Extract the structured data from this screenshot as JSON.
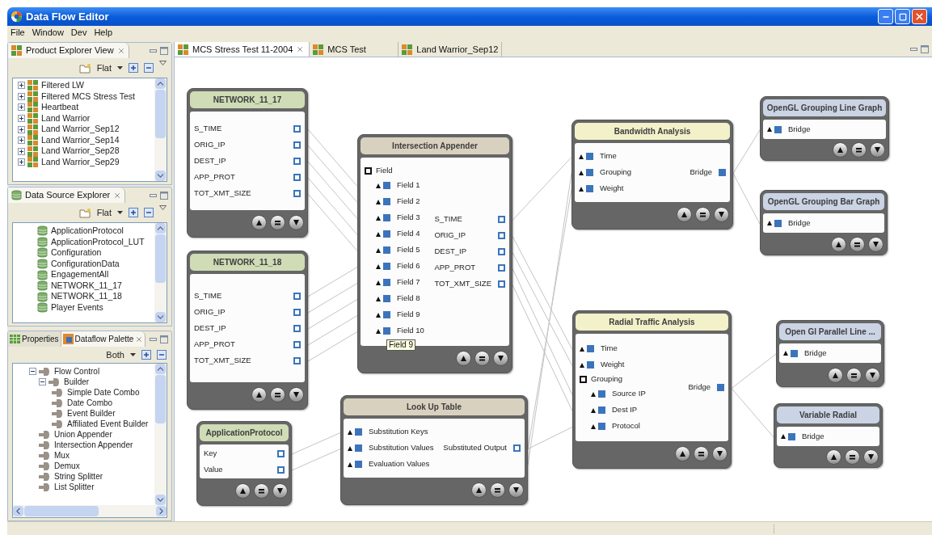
{
  "window": {
    "title": "Data Flow Editor"
  },
  "menu": [
    "File",
    "Window",
    "Dev",
    "Help"
  ],
  "product_explorer": {
    "tab": "Product Explorer View",
    "filter": "Flat",
    "items": [
      {
        "label": "Filtered LW",
        "expanded": false
      },
      {
        "label": "Filtered MCS Stress Test",
        "expanded": false
      },
      {
        "label": "Heartbeat",
        "expanded": false
      },
      {
        "label": "Land Warrior",
        "expanded": false
      },
      {
        "label": "Land Warrior_Sep12",
        "expanded": false
      },
      {
        "label": "Land Warrior_Sep14",
        "expanded": false
      },
      {
        "label": "Land Warrior_Sep28",
        "expanded": false
      },
      {
        "label": "Land Warrior_Sep29",
        "expanded": false
      }
    ]
  },
  "data_source_explorer": {
    "tab": "Data Source Explorer",
    "filter": "Flat",
    "items": [
      "ApplicationProtocol",
      "ApplicationProtocol_LUT",
      "Configuration",
      "ConfigurationData",
      "EngagementAll",
      "NETWORK_11_17",
      "NETWORK_11_18",
      "Player Events"
    ]
  },
  "palette": {
    "tabs": [
      {
        "label": "Properties",
        "selected": false
      },
      {
        "label": "Dataflow Palette",
        "selected": true
      }
    ],
    "filter": "Both",
    "tree": [
      {
        "label": "Flow Control",
        "expanded": true,
        "children": [
          {
            "label": "Builder",
            "expanded": true,
            "children": [
              {
                "label": "Simple Date Combo"
              },
              {
                "label": "Date Combo"
              },
              {
                "label": "Event Builder"
              },
              {
                "label": "Affiliated Event Builder"
              }
            ]
          },
          {
            "label": "Union Appender"
          },
          {
            "label": "Intersection Appender"
          },
          {
            "label": "Mux"
          },
          {
            "label": "Demux"
          },
          {
            "label": "String Splitter"
          },
          {
            "label": "List Splitter"
          }
        ]
      }
    ]
  },
  "editor_tabs": [
    {
      "label": "MCS Stress Test 11-2004",
      "selected": true
    },
    {
      "label": "MCS Test",
      "selected": false
    },
    {
      "label": "Land Warrior_Sep12",
      "selected": false
    }
  ],
  "nodes": [
    {
      "title": "NETWORK_11_17",
      "kind": "source",
      "ports": [
        {
          "label": "S_TIME",
          "kind": "out",
          "filled": false
        },
        {
          "label": "ORIG_IP",
          "kind": "out",
          "filled": false
        },
        {
          "label": "DEST_IP",
          "kind": "out",
          "filled": false
        },
        {
          "label": "APP_PROT",
          "kind": "out",
          "filled": false
        },
        {
          "label": "TOT_XMT_SIZE",
          "kind": "out",
          "filled": false
        }
      ]
    },
    {
      "title": "NETWORK_11_18",
      "kind": "source",
      "ports": [
        {
          "label": "S_TIME",
          "kind": "out",
          "filled": false
        },
        {
          "label": "ORIG_IP",
          "kind": "out",
          "filled": false
        },
        {
          "label": "DEST_IP",
          "kind": "out",
          "filled": false
        },
        {
          "label": "APP_PROT",
          "kind": "out",
          "filled": false
        },
        {
          "label": "TOT_XMT_SIZE",
          "kind": "out",
          "filled": false
        }
      ]
    },
    {
      "title": "Intersection Appender",
      "kind": "operator",
      "ports": [
        {
          "label": "Field",
          "kind": "group",
          "children": [
            {
              "label": "Field 1",
              "kind": "in"
            },
            {
              "label": "Field 2",
              "kind": "in"
            },
            {
              "label": "Field 3",
              "kind": "in"
            },
            {
              "label": "Field 4",
              "kind": "in"
            },
            {
              "label": "Field 5",
              "kind": "in"
            },
            {
              "label": "Field 6",
              "kind": "in"
            },
            {
              "label": "Field 7",
              "kind": "in"
            },
            {
              "label": "Field 8",
              "kind": "in"
            },
            {
              "label": "Field 9",
              "kind": "in"
            },
            {
              "label": "Field 10",
              "kind": "in"
            }
          ]
        },
        {
          "label": "S_TIME",
          "kind": "out",
          "filled": false
        },
        {
          "label": "ORIG_IP",
          "kind": "out",
          "filled": false
        },
        {
          "label": "DEST_IP",
          "kind": "out",
          "filled": false
        },
        {
          "label": "APP_PROT",
          "kind": "out",
          "filled": false
        },
        {
          "label": "TOT_XMT_SIZE",
          "kind": "out",
          "filled": false
        }
      ]
    },
    {
      "title": "ApplicationProtocol",
      "kind": "source",
      "ports": [
        {
          "label": "Key",
          "kind": "out",
          "filled": false
        },
        {
          "label": "Value",
          "kind": "out",
          "filled": false
        }
      ]
    },
    {
      "title": "Look Up Table",
      "kind": "operator",
      "ports": [
        {
          "label": "Substitution Keys",
          "kind": "in"
        },
        {
          "label": "Substitution Values",
          "kind": "in"
        },
        {
          "label": "Evaluation Values",
          "kind": "in"
        },
        {
          "label": "Substituted Output",
          "kind": "out",
          "filled": false
        }
      ]
    },
    {
      "title": "Bandwidth Analysis",
      "kind": "analysis",
      "ports": [
        {
          "label": "Time",
          "kind": "in"
        },
        {
          "label": "Grouping",
          "kind": "in"
        },
        {
          "label": "Weight",
          "kind": "in"
        },
        {
          "label": "Bridge",
          "kind": "out",
          "filled": true
        }
      ]
    },
    {
      "title": "Radial Traffic Analysis",
      "kind": "analysis",
      "ports": [
        {
          "label": "Time",
          "kind": "in"
        },
        {
          "label": "Weight",
          "kind": "in"
        },
        {
          "label": "Grouping",
          "kind": "group",
          "children": [
            {
              "label": "Source IP",
              "kind": "in"
            },
            {
              "label": "Dest IP",
              "kind": "in"
            },
            {
              "label": "Protocol",
              "kind": "in"
            }
          ]
        },
        {
          "label": "Bridge",
          "kind": "out",
          "filled": true
        }
      ]
    },
    {
      "title": "OpenGL Grouping Line Graph",
      "kind": "display",
      "ports": [
        {
          "label": "Bridge",
          "kind": "in"
        }
      ]
    },
    {
      "title": "OpenGL Grouping Bar Graph",
      "kind": "display",
      "ports": [
        {
          "label": "Bridge",
          "kind": "in"
        }
      ]
    },
    {
      "title": "Open Gl Parallel Line ...",
      "kind": "display",
      "ports": [
        {
          "label": "Bridge",
          "kind": "in"
        }
      ]
    },
    {
      "title": "Variable Radial",
      "kind": "display",
      "ports": [
        {
          "label": "Bridge",
          "kind": "in"
        }
      ]
    }
  ],
  "tooltip": {
    "text": "Field 9"
  }
}
